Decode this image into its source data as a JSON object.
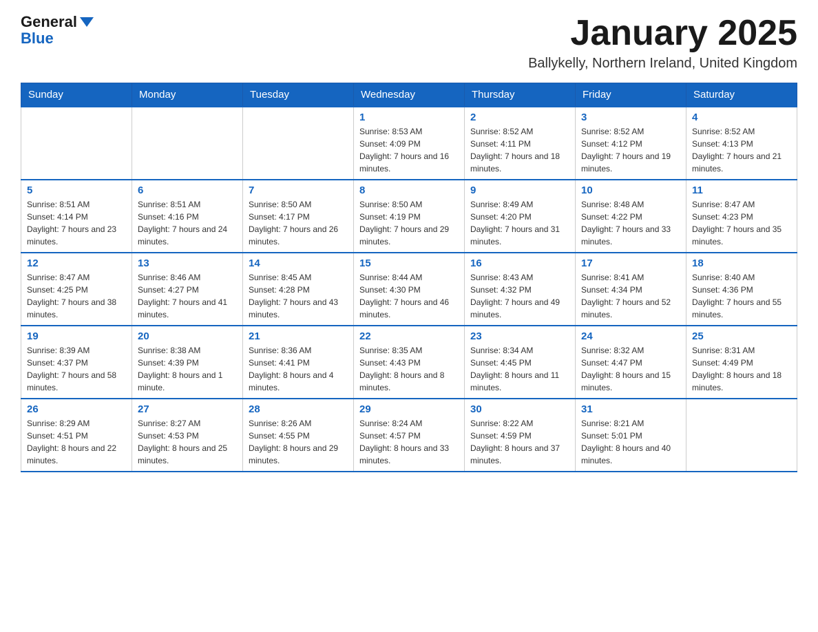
{
  "logo": {
    "line1": "General",
    "line2": "Blue"
  },
  "header": {
    "title": "January 2025",
    "subtitle": "Ballykelly, Northern Ireland, United Kingdom"
  },
  "days_of_week": [
    "Sunday",
    "Monday",
    "Tuesday",
    "Wednesday",
    "Thursday",
    "Friday",
    "Saturday"
  ],
  "weeks": [
    [
      {
        "day": "",
        "info": ""
      },
      {
        "day": "",
        "info": ""
      },
      {
        "day": "",
        "info": ""
      },
      {
        "day": "1",
        "info": "Sunrise: 8:53 AM\nSunset: 4:09 PM\nDaylight: 7 hours and 16 minutes."
      },
      {
        "day": "2",
        "info": "Sunrise: 8:52 AM\nSunset: 4:11 PM\nDaylight: 7 hours and 18 minutes."
      },
      {
        "day": "3",
        "info": "Sunrise: 8:52 AM\nSunset: 4:12 PM\nDaylight: 7 hours and 19 minutes."
      },
      {
        "day": "4",
        "info": "Sunrise: 8:52 AM\nSunset: 4:13 PM\nDaylight: 7 hours and 21 minutes."
      }
    ],
    [
      {
        "day": "5",
        "info": "Sunrise: 8:51 AM\nSunset: 4:14 PM\nDaylight: 7 hours and 23 minutes."
      },
      {
        "day": "6",
        "info": "Sunrise: 8:51 AM\nSunset: 4:16 PM\nDaylight: 7 hours and 24 minutes."
      },
      {
        "day": "7",
        "info": "Sunrise: 8:50 AM\nSunset: 4:17 PM\nDaylight: 7 hours and 26 minutes."
      },
      {
        "day": "8",
        "info": "Sunrise: 8:50 AM\nSunset: 4:19 PM\nDaylight: 7 hours and 29 minutes."
      },
      {
        "day": "9",
        "info": "Sunrise: 8:49 AM\nSunset: 4:20 PM\nDaylight: 7 hours and 31 minutes."
      },
      {
        "day": "10",
        "info": "Sunrise: 8:48 AM\nSunset: 4:22 PM\nDaylight: 7 hours and 33 minutes."
      },
      {
        "day": "11",
        "info": "Sunrise: 8:47 AM\nSunset: 4:23 PM\nDaylight: 7 hours and 35 minutes."
      }
    ],
    [
      {
        "day": "12",
        "info": "Sunrise: 8:47 AM\nSunset: 4:25 PM\nDaylight: 7 hours and 38 minutes."
      },
      {
        "day": "13",
        "info": "Sunrise: 8:46 AM\nSunset: 4:27 PM\nDaylight: 7 hours and 41 minutes."
      },
      {
        "day": "14",
        "info": "Sunrise: 8:45 AM\nSunset: 4:28 PM\nDaylight: 7 hours and 43 minutes."
      },
      {
        "day": "15",
        "info": "Sunrise: 8:44 AM\nSunset: 4:30 PM\nDaylight: 7 hours and 46 minutes."
      },
      {
        "day": "16",
        "info": "Sunrise: 8:43 AM\nSunset: 4:32 PM\nDaylight: 7 hours and 49 minutes."
      },
      {
        "day": "17",
        "info": "Sunrise: 8:41 AM\nSunset: 4:34 PM\nDaylight: 7 hours and 52 minutes."
      },
      {
        "day": "18",
        "info": "Sunrise: 8:40 AM\nSunset: 4:36 PM\nDaylight: 7 hours and 55 minutes."
      }
    ],
    [
      {
        "day": "19",
        "info": "Sunrise: 8:39 AM\nSunset: 4:37 PM\nDaylight: 7 hours and 58 minutes."
      },
      {
        "day": "20",
        "info": "Sunrise: 8:38 AM\nSunset: 4:39 PM\nDaylight: 8 hours and 1 minute."
      },
      {
        "day": "21",
        "info": "Sunrise: 8:36 AM\nSunset: 4:41 PM\nDaylight: 8 hours and 4 minutes."
      },
      {
        "day": "22",
        "info": "Sunrise: 8:35 AM\nSunset: 4:43 PM\nDaylight: 8 hours and 8 minutes."
      },
      {
        "day": "23",
        "info": "Sunrise: 8:34 AM\nSunset: 4:45 PM\nDaylight: 8 hours and 11 minutes."
      },
      {
        "day": "24",
        "info": "Sunrise: 8:32 AM\nSunset: 4:47 PM\nDaylight: 8 hours and 15 minutes."
      },
      {
        "day": "25",
        "info": "Sunrise: 8:31 AM\nSunset: 4:49 PM\nDaylight: 8 hours and 18 minutes."
      }
    ],
    [
      {
        "day": "26",
        "info": "Sunrise: 8:29 AM\nSunset: 4:51 PM\nDaylight: 8 hours and 22 minutes."
      },
      {
        "day": "27",
        "info": "Sunrise: 8:27 AM\nSunset: 4:53 PM\nDaylight: 8 hours and 25 minutes."
      },
      {
        "day": "28",
        "info": "Sunrise: 8:26 AM\nSunset: 4:55 PM\nDaylight: 8 hours and 29 minutes."
      },
      {
        "day": "29",
        "info": "Sunrise: 8:24 AM\nSunset: 4:57 PM\nDaylight: 8 hours and 33 minutes."
      },
      {
        "day": "30",
        "info": "Sunrise: 8:22 AM\nSunset: 4:59 PM\nDaylight: 8 hours and 37 minutes."
      },
      {
        "day": "31",
        "info": "Sunrise: 8:21 AM\nSunset: 5:01 PM\nDaylight: 8 hours and 40 minutes."
      },
      {
        "day": "",
        "info": ""
      }
    ]
  ]
}
